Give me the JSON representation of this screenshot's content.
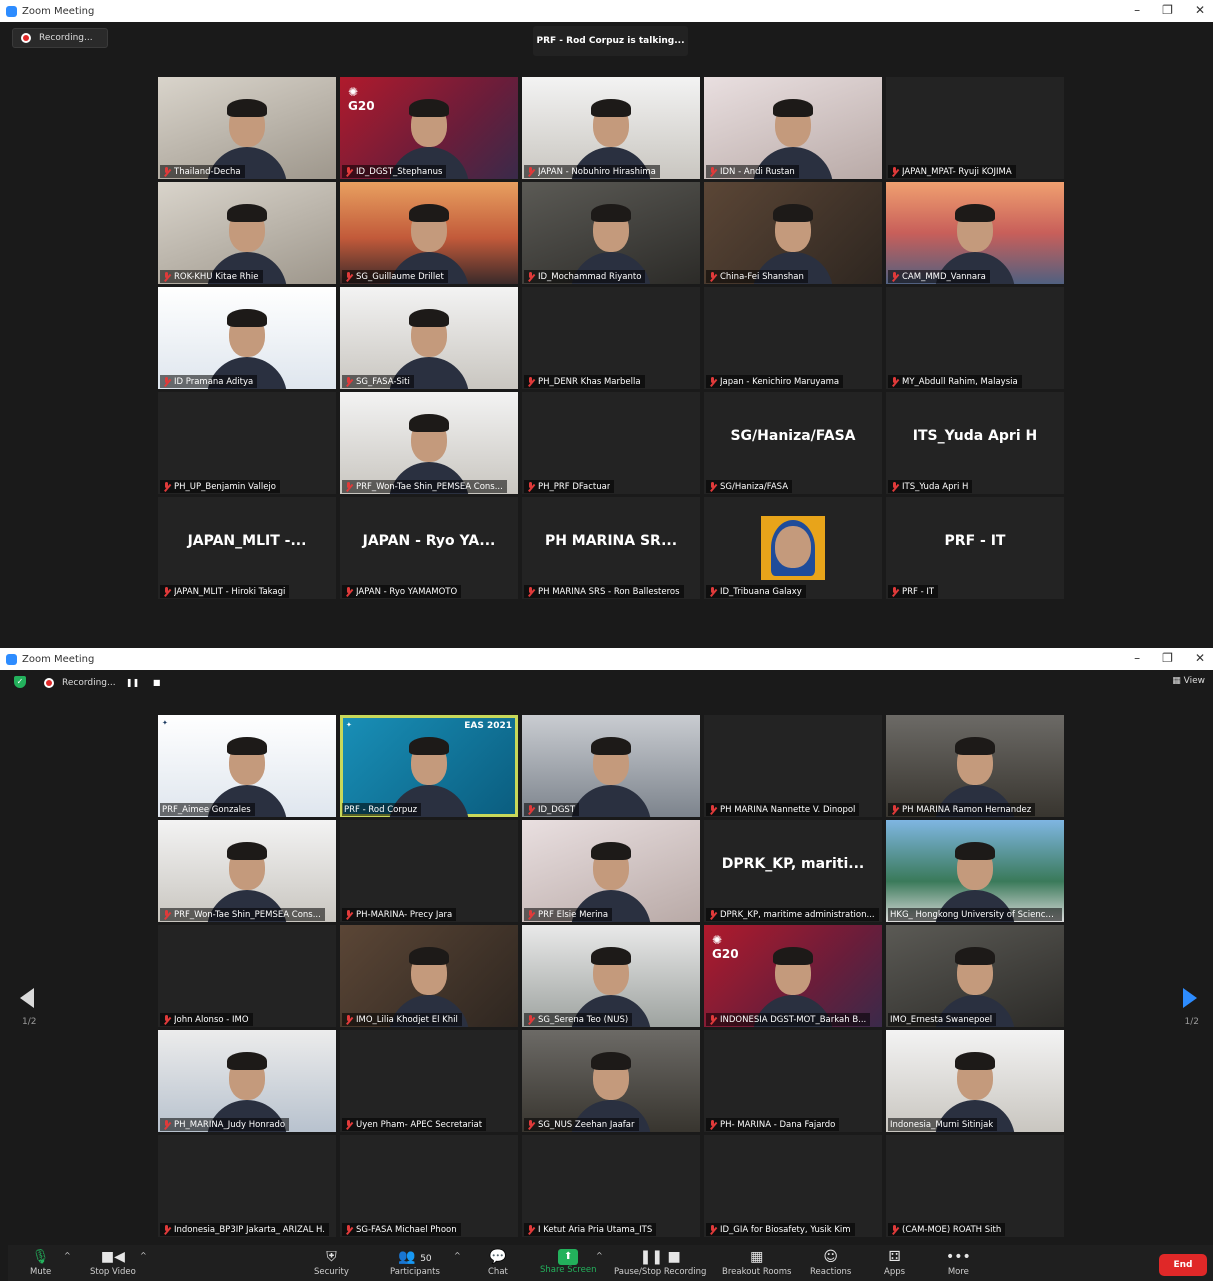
{
  "window1": {
    "title": "Zoom Meeting",
    "recording_label": "Recording...",
    "talking_label": "PRF - Rod Corpuz is talking...",
    "tiles": [
      {
        "name": "Thailand-Decha",
        "display": "",
        "bg": "hasvid bg-office"
      },
      {
        "name": "ID_DGST_Stephanus",
        "display": "",
        "bg": "bg-red",
        "logo": "G20"
      },
      {
        "name": "JAPAN - Nobuhiro Hirashima",
        "display": "",
        "bg": "bg-room"
      },
      {
        "name": "IDN - Andi Rustan",
        "display": "",
        "bg": "bg-pink"
      },
      {
        "name": "JAPAN_MPAT- Ryuji KOJIMA",
        "display": "",
        "bg": ""
      },
      {
        "name": "ROK-KHU Kitae Rhie",
        "display": "",
        "bg": "bg-office"
      },
      {
        "name": "SG_Guillaume Drillet",
        "display": "",
        "bg": "bg-sunset"
      },
      {
        "name": "ID_Mochammad Riyanto",
        "display": "",
        "bg": "bg-dark"
      },
      {
        "name": "China-Fei Shanshan",
        "display": "",
        "bg": "bg-brown"
      },
      {
        "name": "CAM_MMD_Vannara",
        "display": "",
        "bg": "bg-bridge"
      },
      {
        "name": "ID Pramana Aditya",
        "display": "",
        "bg": "bg-white"
      },
      {
        "name": "SG_FASA-Siti",
        "display": "",
        "bg": "bg-room"
      },
      {
        "name": "PH_DENR Khas Marbella",
        "display": "",
        "bg": ""
      },
      {
        "name": "Japan - Kenichiro Maruyama",
        "display": "",
        "bg": ""
      },
      {
        "name": "MY_Abdull Rahim, Malaysia",
        "display": "",
        "bg": ""
      },
      {
        "name": "PH_UP_Benjamin Vallejo",
        "display": "",
        "bg": ""
      },
      {
        "name": "PRF_Won-Tae Shin_PEMSEA Cons...",
        "display": "",
        "bg": "bg-room"
      },
      {
        "name": "PH_PRF DFactuar",
        "display": "",
        "bg": ""
      },
      {
        "name": "SG/Haniza/FASA",
        "display": "SG/Haniza/FASA",
        "bg": ""
      },
      {
        "name": "ITS_Yuda Apri H",
        "display": "ITS_Yuda Apri H",
        "bg": ""
      },
      {
        "name": "JAPAN_MLIT - Hiroki Takagi",
        "display": "JAPAN_MLIT -...",
        "bg": ""
      },
      {
        "name": "JAPAN - Ryo YAMAMOTO",
        "display": "JAPAN - Ryo YA...",
        "bg": ""
      },
      {
        "name": "PH MARINA SRS - Ron Ballesteros",
        "display": "PH MARINA SR...",
        "bg": ""
      },
      {
        "name": "ID_Tribuana Galaxy",
        "display": "",
        "bg": "",
        "photo": true
      },
      {
        "name": "PRF - IT",
        "display": "PRF - IT",
        "bg": ""
      }
    ]
  },
  "window2": {
    "title": "Zoom Meeting",
    "recording_label": "Recording...",
    "view_label": "View",
    "page_left": "1/2",
    "page_right": "1/2",
    "tiles": [
      {
        "name": "PRF_Aimee Gonzales",
        "display": "",
        "bg": "bg-white",
        "logo": "PEMSEA"
      },
      {
        "name": "PRF - Rod Corpuz",
        "display": "",
        "bg": "bg-teal highlight",
        "logo": "PEMSEA",
        "eas": "EAS 2021"
      },
      {
        "name": "ID_DGST",
        "display": "",
        "bg": "bg-meeting"
      },
      {
        "name": "PH MARINA Nannette V. Dinopol",
        "display": "",
        "bg": ""
      },
      {
        "name": "PH MARINA Ramon Hernandez",
        "display": "",
        "bg": "bg-mid"
      },
      {
        "name": "PRF_Won-Tae Shin_PEMSEA Cons...",
        "display": "",
        "bg": "bg-room"
      },
      {
        "name": "PH-MARINA- Precy Jara",
        "display": "",
        "bg": ""
      },
      {
        "name": "PRF Elsie Merina",
        "display": "",
        "bg": "bg-pink"
      },
      {
        "name": "DPRK_KP, maritime administration...",
        "display": "DPRK_KP,  mariti...",
        "bg": ""
      },
      {
        "name": "HKG_ Hongkong University of Science...",
        "display": "",
        "bg": "bg-hk"
      },
      {
        "name": "John Alonso - IMO",
        "display": "",
        "bg": ""
      },
      {
        "name": "IMO_Lilia Khodjet El Khil",
        "display": "",
        "bg": "bg-brown"
      },
      {
        "name": "SG_Serena Teo (NUS)",
        "display": "",
        "bg": "bg-plant"
      },
      {
        "name": "INDONESIA DGST-MOT_Barkah B...",
        "display": "",
        "bg": "bg-red",
        "logo": "G20"
      },
      {
        "name": "IMO_Ernesta Swanepoel",
        "display": "",
        "bg": "bg-dark"
      },
      {
        "name": "PH_MARINA_Judy Honrado",
        "display": "",
        "bg": "bg-blue"
      },
      {
        "name": "Uyen Pham- APEC Secretariat",
        "display": "",
        "bg": ""
      },
      {
        "name": "SG_NUS Zeehan Jaafar",
        "display": "",
        "bg": "bg-mid"
      },
      {
        "name": "PH- MARINA - Dana Fajardo",
        "display": "",
        "bg": ""
      },
      {
        "name": "Indonesia_Murni Sitinjak",
        "display": "",
        "bg": "bg-room"
      },
      {
        "name": "Indonesia_BP3IP Jakarta_ ARIZAL H.",
        "display": "",
        "bg": ""
      },
      {
        "name": "SG-FASA  Michael Phoon",
        "display": "",
        "bg": ""
      },
      {
        "name": "I Ketut Aria Pria Utama_ITS",
        "display": "",
        "bg": ""
      },
      {
        "name": "ID_GIA for Biosafety, Yusik Kim",
        "display": "",
        "bg": ""
      },
      {
        "name": "(CAM-MOE) ROATH Sith",
        "display": "",
        "bg": ""
      }
    ],
    "toolbar": {
      "mute": "Mute",
      "stop_video": "Stop Video",
      "security": "Security",
      "participants": "Participants",
      "participant_count": "50",
      "chat": "Chat",
      "share_screen": "Share Screen",
      "pause_recording": "Pause/Stop Recording",
      "breakout": "Breakout Rooms",
      "reactions": "Reactions",
      "apps": "Apps",
      "more": "More",
      "end": "End"
    }
  }
}
